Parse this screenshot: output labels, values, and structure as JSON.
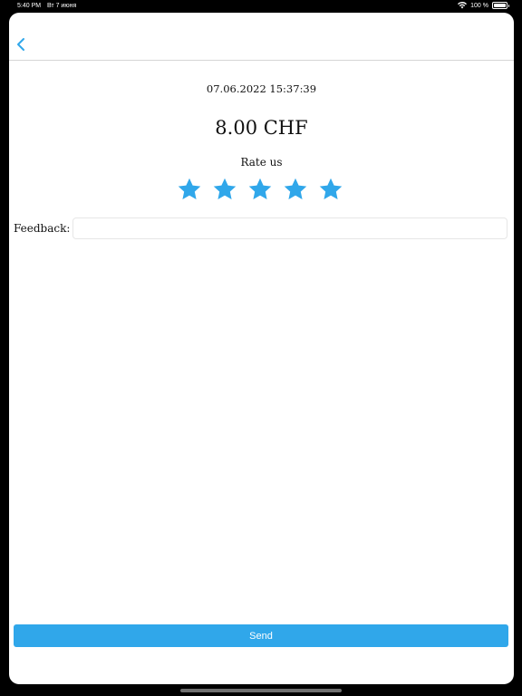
{
  "status_bar": {
    "time": "5:40 PM",
    "date": "Вт 7 июня",
    "battery": "100 %",
    "battery_level": 1.0,
    "wifi_icon": "wifi-icon"
  },
  "nav": {
    "back_icon": "chevron-left-icon"
  },
  "transaction": {
    "datetime": "07.06.2022 15:37:39",
    "amount": "8.00 CHF"
  },
  "rating": {
    "label": "Rate us",
    "stars_total": 5,
    "stars_filled": 5,
    "star_icon": "star-icon"
  },
  "feedback": {
    "label": "Feedback:",
    "value": "",
    "placeholder": ""
  },
  "actions": {
    "send_label": "Send"
  },
  "colors": {
    "accent": "#30a7ea",
    "star": "#30a7ea",
    "background": "#ffffff",
    "frame": "#000000"
  }
}
